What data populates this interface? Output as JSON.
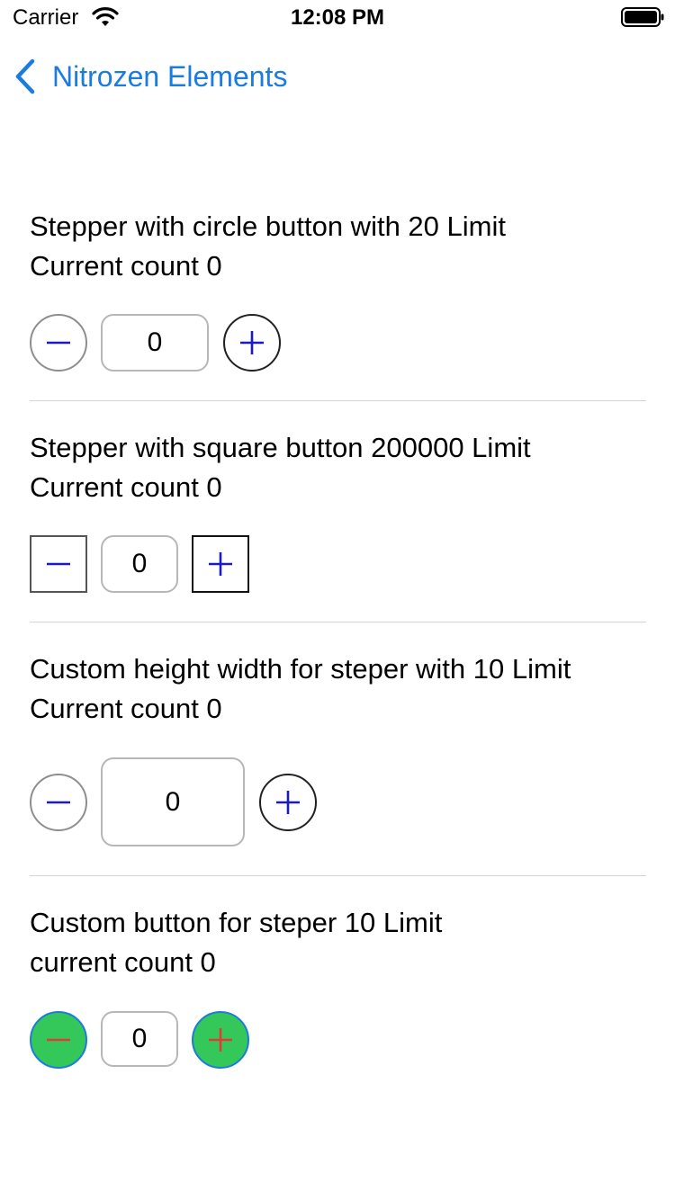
{
  "status_bar": {
    "carrier": "Carrier",
    "time": "12:08 PM",
    "wifi_icon": "wifi-icon",
    "battery_icon": "battery-icon"
  },
  "nav": {
    "back_label": "Nitrozen Elements",
    "back_icon": "chevron-left-icon",
    "accent_color": "#1a7be0"
  },
  "sections": [
    {
      "title": "Stepper with circle button with 20 Limit",
      "count_text": "Current count 0",
      "value": "0",
      "button_style": "circle",
      "decrement_icon": "minus-icon",
      "increment_icon": "plus-icon"
    },
    {
      "title": "Stepper with square button 200000 Limit",
      "count_text": "Current count 0",
      "value": "0",
      "button_style": "square",
      "decrement_icon": "minus-icon",
      "increment_icon": "plus-icon"
    },
    {
      "title": "Custom height width for steper with 10 Limit",
      "count_text": "Current count 0",
      "value": "0",
      "button_style": "circle",
      "decrement_icon": "minus-icon",
      "increment_icon": "plus-icon"
    },
    {
      "title": "Custom button for steper 10 Limit",
      "count_text": "current count 0",
      "value": "0",
      "button_style": "custom-green-circle",
      "decrement_icon": "minus-icon",
      "increment_icon": "plus-icon",
      "button_fill": "#34c759",
      "button_border": "#1a7be0",
      "icon_color": "#e53935"
    }
  ],
  "colors": {
    "stepper_icon": "#1a1acc",
    "divider": "#d4d4d8"
  }
}
